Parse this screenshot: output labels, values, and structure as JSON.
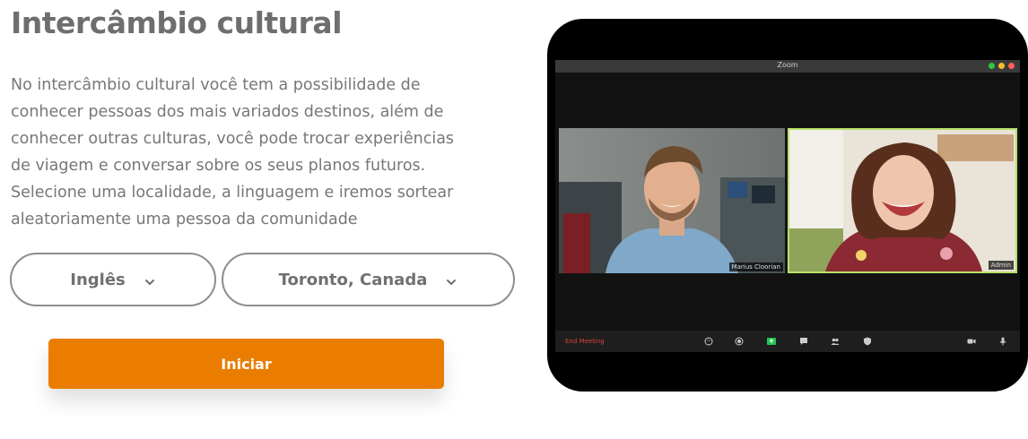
{
  "section": {
    "title": "Intercâmbio cultural",
    "description_lines": [
      "No intercâmbio cultural você tem a possibilidade de",
      "conhecer pessoas dos mais variados destinos, além de",
      "conhecer outras culturas, você pode trocar experiências",
      "de viagem e conversar sobre os seus planos futuros.",
      "Selecione uma localidade, a linguagem e iremos sortear",
      "aleatoriamente uma pessoa da comunidade"
    ]
  },
  "form": {
    "language_select": {
      "value": "Inglês",
      "icon": "chevron-down-icon"
    },
    "location_select": {
      "value": "Toronto, Canada",
      "icon": "chevron-down-icon"
    },
    "start_button": {
      "label": "Iniciar",
      "color": "#ea7d00"
    }
  },
  "video_call": {
    "window_title": "Zoom",
    "participants": [
      {
        "name": "Marius Cloorian"
      },
      {
        "name": "Admin"
      }
    ],
    "end_meeting_label": "End Meeting",
    "colors": {
      "active_speaker_border": "#b9e36b",
      "end_meeting": "#e0413a"
    }
  }
}
